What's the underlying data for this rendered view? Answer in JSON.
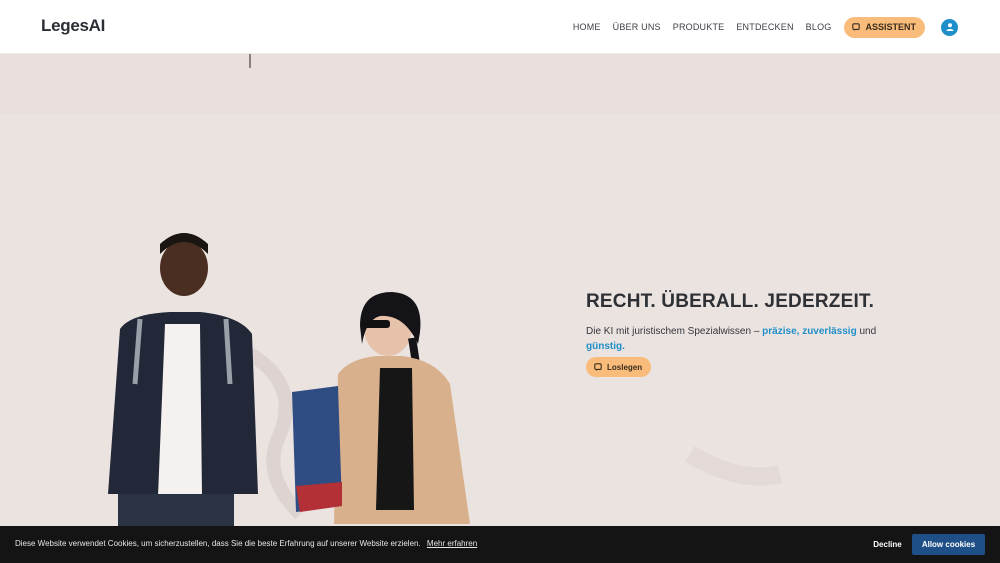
{
  "header": {
    "logo_text": "LegesAI",
    "nav": [
      "HOME",
      "ÜBER UNS",
      "PRODUKTE",
      "ENTDECKEN",
      "BLOG"
    ],
    "assistant_label": "ASSISTENT"
  },
  "hero": {
    "title": "RECHT. ÜBERALL. JEDERZEIT.",
    "text_intro": "Die KI mit juristischem Spezialwissen –",
    "hl_1": "präzise",
    "comma": ",",
    "hl_2": "zuverlässig",
    "and": "und",
    "hl_3": "günstig",
    "dot": ".",
    "cta_label": "Loslegen"
  },
  "cookie": {
    "message": "Diese Website verwendet Cookies, um sicherzustellen, dass Sie die beste Erfahrung auf unserer Website erzielen.",
    "link": "Mehr erfahren",
    "decline": "Decline",
    "allow": "Allow cookies"
  },
  "colors": {
    "accent": "#1f8fc9",
    "button": "#f9bc7b",
    "cookie_bg": "#141414",
    "allow_bg": "#1e4f86"
  }
}
